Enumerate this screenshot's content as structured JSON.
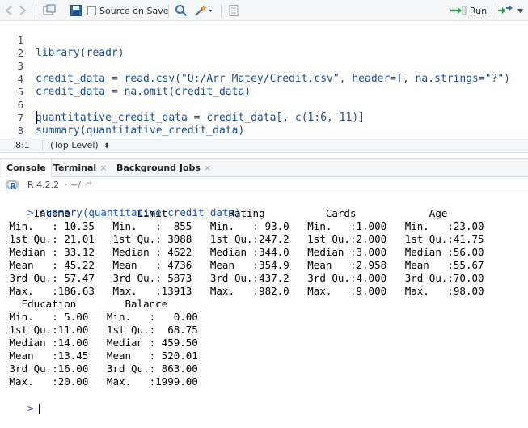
{
  "toolbar": {
    "source_on_save": "Source on Save",
    "run": "Run"
  },
  "editor": {
    "lines": [
      {
        "num": "1",
        "text": "library(readr)"
      },
      {
        "num": "2",
        "text": ""
      },
      {
        "num": "3",
        "text": "credit_data = read.csv(\"O:/Arr Matey/Credit.csv\", header=T, na.strings=\"?\")"
      },
      {
        "num": "4",
        "text": "credit_data = na.omit(credit_data)"
      },
      {
        "num": "5",
        "text": ""
      },
      {
        "num": "6",
        "text": "quantitative_credit_data = credit_data[, c(1:6, 11)]"
      },
      {
        "num": "7",
        "text": "summary(quantitative_credit_data)"
      },
      {
        "num": "8",
        "text": ""
      }
    ]
  },
  "statusbar": {
    "position": "8:1",
    "scope": "(Top Level)",
    "scope_arrow": "⬍"
  },
  "tabs": [
    {
      "label": "Console",
      "close": ""
    },
    {
      "label": "Terminal",
      "close": "×"
    },
    {
      "label": "Background Jobs",
      "close": "×"
    }
  ],
  "console_header": {
    "r_version": "R 4.2.2",
    "path": "· ~/"
  },
  "console": {
    "command": "summary(quantitative_credit_data)",
    "output": [
      "     Income           Limit          Rating          Cards            Age       ",
      " Min.   : 10.35   Min.   :  855   Min.   : 93.0   Min.   :1.000   Min.   :23.00  ",
      " 1st Qu.: 21.01   1st Qu.: 3088   1st Qu.:247.2   1st Qu.:2.000   1st Qu.:41.75  ",
      " Median : 33.12   Median : 4622   Median :344.0   Median :3.000   Median :56.00  ",
      " Mean   : 45.22   Mean   : 4736   Mean   :354.9   Mean   :2.958   Mean   :55.67  ",
      " 3rd Qu.: 57.47   3rd Qu.: 5873   3rd Qu.:437.2   3rd Qu.:4.000   3rd Qu.:70.00  ",
      " Max.   :186.63   Max.   :13913   Max.   :982.0   Max.   :9.000   Max.   :98.00  ",
      "   Education        Balance       ",
      " Min.   : 5.00   Min.   :   0.00  ",
      " 1st Qu.:11.00   1st Qu.:  68.75  ",
      " Median :14.00   Median : 459.50  ",
      " Mean   :13.45   Mean   : 520.01  ",
      " 3rd Qu.:16.00   3rd Qu.: 863.00  ",
      " Max.   :20.00   Max.   :1999.00  "
    ],
    "prompt": ">"
  }
}
